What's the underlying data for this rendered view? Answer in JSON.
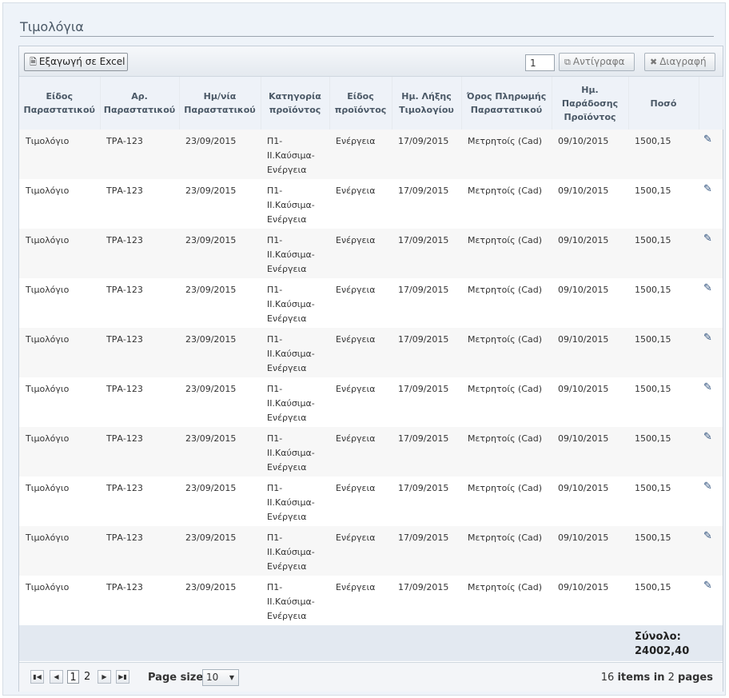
{
  "page": {
    "title": "Τιμολόγια"
  },
  "toolbar": {
    "export_label": "Εξαγωγή σε Excel",
    "copies_value": "1",
    "copy_label": "Αντίγραφα",
    "delete_label": "Διαγραφή"
  },
  "columns": [
    "Είδος Παραστατικού",
    "Αρ. Παραστατικού",
    "Ημ/νία Παραστατικού",
    "Κατηγορία προϊόντος",
    "Είδος προϊόντος",
    "Ημ. Λήξης Τιμολογίου",
    "Όρος Πληρωμής Παραστατικού",
    "Ημ. Παράδοσης Προϊόντος",
    "Ποσό"
  ],
  "rows": [
    [
      "Τιμολόγιο",
      "ΤΡΑ-123",
      "23/09/2015",
      "Π1-\nΙΙ.Καύσιμα-\nΕνέργεια",
      "Ενέργεια",
      "17/09/2015",
      "Μετρητοίς (Cad)",
      "09/10/2015",
      "1500,15"
    ],
    [
      "Τιμολόγιο",
      "ΤΡΑ-123",
      "23/09/2015",
      "Π1-\nΙΙ.Καύσιμα-\nΕνέργεια",
      "Ενέργεια",
      "17/09/2015",
      "Μετρητοίς (Cad)",
      "09/10/2015",
      "1500,15"
    ],
    [
      "Τιμολόγιο",
      "ΤΡΑ-123",
      "23/09/2015",
      "Π1-\nΙΙ.Καύσιμα-\nΕνέργεια",
      "Ενέργεια",
      "17/09/2015",
      "Μετρητοίς (Cad)",
      "09/10/2015",
      "1500,15"
    ],
    [
      "Τιμολόγιο",
      "ΤΡΑ-123",
      "23/09/2015",
      "Π1-\nΙΙ.Καύσιμα-\nΕνέργεια",
      "Ενέργεια",
      "17/09/2015",
      "Μετρητοίς (Cad)",
      "09/10/2015",
      "1500,15"
    ],
    [
      "Τιμολόγιο",
      "ΤΡΑ-123",
      "23/09/2015",
      "Π1-\nΙΙ.Καύσιμα-\nΕνέργεια",
      "Ενέργεια",
      "17/09/2015",
      "Μετρητοίς (Cad)",
      "09/10/2015",
      "1500,15"
    ],
    [
      "Τιμολόγιο",
      "ΤΡΑ-123",
      "23/09/2015",
      "Π1-\nΙΙ.Καύσιμα-\nΕνέργεια",
      "Ενέργεια",
      "17/09/2015",
      "Μετρητοίς (Cad)",
      "09/10/2015",
      "1500,15"
    ],
    [
      "Τιμολόγιο",
      "ΤΡΑ-123",
      "23/09/2015",
      "Π1-\nΙΙ.Καύσιμα-\nΕνέργεια",
      "Ενέργεια",
      "17/09/2015",
      "Μετρητοίς (Cad)",
      "09/10/2015",
      "1500,15"
    ],
    [
      "Τιμολόγιο",
      "ΤΡΑ-123",
      "23/09/2015",
      "Π1-\nΙΙ.Καύσιμα-\nΕνέργεια",
      "Ενέργεια",
      "17/09/2015",
      "Μετρητοίς (Cad)",
      "09/10/2015",
      "1500,15"
    ],
    [
      "Τιμολόγιο",
      "ΤΡΑ-123",
      "23/09/2015",
      "Π1-\nΙΙ.Καύσιμα-\nΕνέργεια",
      "Ενέργεια",
      "17/09/2015",
      "Μετρητοίς (Cad)",
      "09/10/2015",
      "1500,15"
    ],
    [
      "Τιμολόγιο",
      "ΤΡΑ-123",
      "23/09/2015",
      "Π1-\nΙΙ.Καύσιμα-\nΕνέργεια",
      "Ενέργεια",
      "17/09/2015",
      "Μετρητοίς (Cad)",
      "09/10/2015",
      "1500,15"
    ]
  ],
  "row_action_icon": "edit-icon",
  "footer": {
    "total_label": "Σύνολο:",
    "total_value": "24002,40"
  },
  "pager": {
    "pages": [
      "1",
      "2"
    ],
    "current_page": "1",
    "page_size_label": "Page size:",
    "page_size": "10",
    "items_count": "16",
    "items_text": "items in",
    "pages_count": "2",
    "pages_text": "pages"
  }
}
